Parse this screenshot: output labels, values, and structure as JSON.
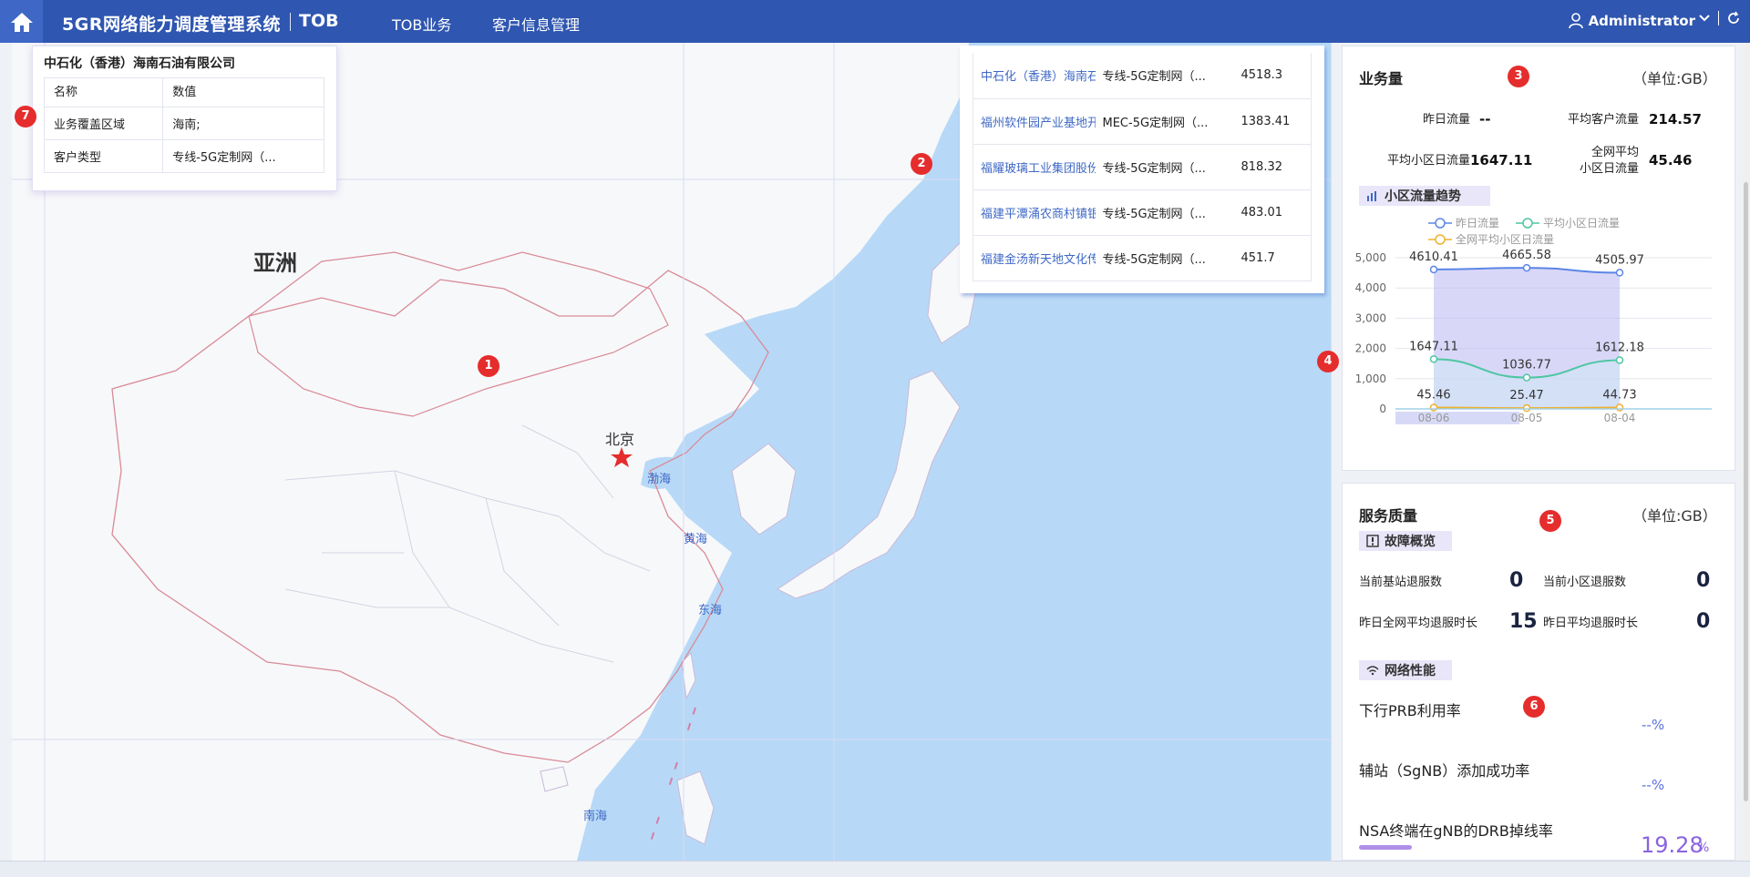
{
  "header": {
    "title": "5GR网络能力调度管理系统",
    "subtitle": "TOB",
    "nav": [
      "TOB业务",
      "客户信息管理"
    ],
    "user": "Administrator",
    "accent": "#2f56b0"
  },
  "map": {
    "region_label": "亚洲",
    "capital": "北京",
    "seas": [
      "渤海",
      "黄海",
      "东海",
      "南海"
    ]
  },
  "info_card": {
    "company": "中石化（香港）海南石油有限公司",
    "header_name": "名称",
    "header_value": "数值",
    "rows": [
      {
        "name": "业务覆盖区域",
        "value": "海南;"
      },
      {
        "name": "客户类型",
        "value": "专线-5G定制网（..."
      }
    ]
  },
  "top_list": [
    {
      "name": "中石化（香港）海南石",
      "type": "专线-5G定制网（...",
      "value": "4518.3"
    },
    {
      "name": "福州软件园产业基地开",
      "type": "MEC-5G定制网（...",
      "value": "1383.41"
    },
    {
      "name": "福耀玻璃工业集团股份",
      "type": "专线-5G定制网（...",
      "value": "818.32"
    },
    {
      "name": "福建平潭涌农商村镇银",
      "type": "专线-5G定制网（...",
      "value": "483.01"
    },
    {
      "name": "福建金汤新天地文化传",
      "type": "专线-5G定制网（...",
      "value": "451.7"
    }
  ],
  "markers": [
    "1",
    "2",
    "3",
    "4",
    "5",
    "6",
    "7"
  ],
  "traffic": {
    "title": "业务量",
    "unit": "（单位:GB）",
    "yesterday_label": "昨日流量",
    "yesterday_value": "--",
    "avg_customer_label": "平均客户流量",
    "avg_customer_value": "214.57",
    "avg_cell_label": "平均小区日流量",
    "avg_cell_value": "1647.11",
    "network_avg_label_1": "全网平均",
    "network_avg_label_2": "小区日流量",
    "network_avg_value": "45.46",
    "trend_tag": "小区流量趋势"
  },
  "chart_data": {
    "type": "line",
    "x": [
      "08-06",
      "08-05",
      "08-04"
    ],
    "ylim": [
      0,
      5000
    ],
    "yticks": [
      "5,000",
      "4,000",
      "3,000",
      "2,000",
      "1,000",
      "0"
    ],
    "series": [
      {
        "name": "昨日流量",
        "values": [
          4610.41,
          4665.58,
          4505.97
        ],
        "color": "#5b86e5"
      },
      {
        "name": "平均小区日流量",
        "values": [
          1647.11,
          1036.77,
          1612.18
        ],
        "color": "#4fc6a3"
      },
      {
        "name": "全网平均小区日流量",
        "values": [
          45.46,
          25.47,
          44.73
        ],
        "color": "#f0b030"
      }
    ],
    "labels": [
      "4610.41",
      "4665.58",
      "4505.97",
      "1647.11",
      "1036.77",
      "1612.18",
      "45.46",
      "25.47",
      "44.73"
    ]
  },
  "quality": {
    "title": "服务质量",
    "unit": "（单位:GB）",
    "fault_tag": "故障概览",
    "station_out_label": "当前基站退服数",
    "station_out_value": "0",
    "cell_out_label": "当前小区退服数",
    "cell_out_value": "0",
    "net_avg_out_label": "昨日全网平均退服时长",
    "net_avg_out_value": "15",
    "avg_out_label": "昨日平均退服时长",
    "avg_out_value": "0",
    "perf_tag": "网络性能",
    "kpis": [
      {
        "label": "下行PRB利用率",
        "value": "--%"
      },
      {
        "label": "辅站（SgNB）添加成功率",
        "value": "--%"
      },
      {
        "label": "NSA终端在gNB的DRB掉线率",
        "value": "19.28"
      }
    ],
    "percent": "%"
  }
}
